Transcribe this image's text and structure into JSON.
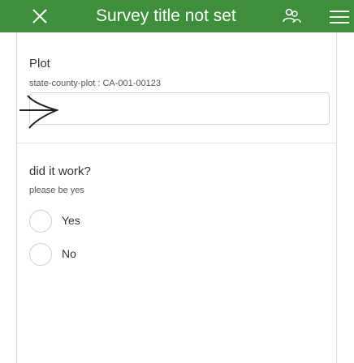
{
  "header": {
    "title": "Survey title not set",
    "close_icon": "close-x-icon",
    "people_icon": "people-icon",
    "menu_icon": "menu-icon",
    "background_color": "#3e8f3c"
  },
  "plot_question": {
    "label": "Plot",
    "hint": "state-county-plot : CA-001-00123",
    "value": ""
  },
  "work_question": {
    "label": "did it work?",
    "hint": "please be yes",
    "options": [
      {
        "label": "Yes"
      },
      {
        "label": "No"
      }
    ]
  }
}
